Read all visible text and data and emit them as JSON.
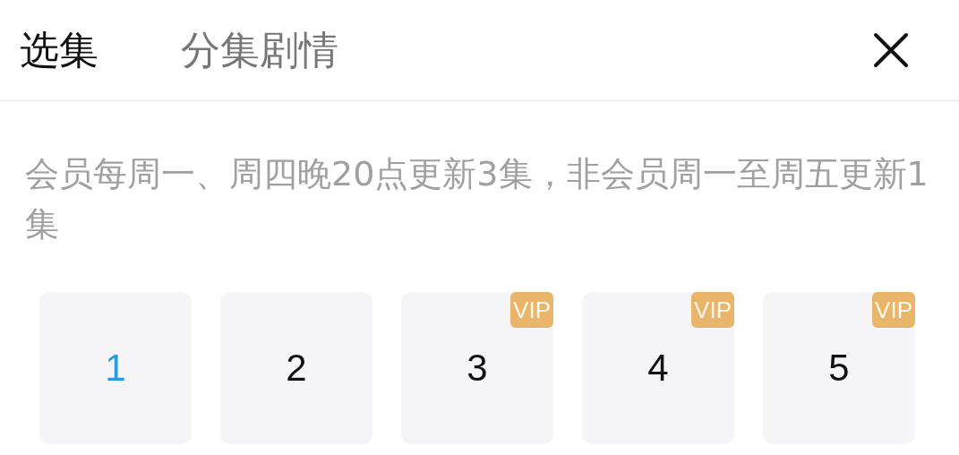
{
  "tabs": [
    {
      "label": "选集",
      "selected": true
    },
    {
      "label": "分集剧情",
      "selected": false
    }
  ],
  "notice": "会员每周一、周四晚20点更新3集，非会员周一至周五更新1集",
  "episodes": [
    {
      "label": "1",
      "selected": true
    },
    {
      "label": "2",
      "selected": false
    },
    {
      "label": "3",
      "selected": false,
      "badge": "VIP"
    },
    {
      "label": "4",
      "selected": false,
      "badge": "VIP"
    },
    {
      "label": "5",
      "selected": false,
      "badge": "VIP"
    }
  ]
}
